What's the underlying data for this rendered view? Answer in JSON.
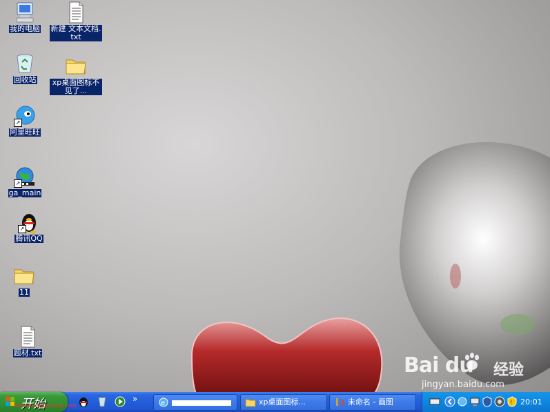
{
  "desktop": {
    "icons": [
      {
        "label": "我的电脑"
      },
      {
        "label": "新建 文本文档.txt"
      },
      {
        "label": "回收站"
      },
      {
        "label": "xp桌面图标不见了..."
      },
      {
        "label": "阿里旺旺"
      },
      {
        "label": "ga_main"
      },
      {
        "label": "腾讯QQ"
      },
      {
        "label": "11"
      },
      {
        "label": "题材.txt"
      }
    ]
  },
  "watermark": {
    "logo": "Bai du",
    "text": "经验",
    "url": "jingyan.baidu.com"
  },
  "taskbar": {
    "start_label": "开始",
    "start_overlay": "www.xitongcheng.com",
    "tasks": [
      {
        "label": "",
        "icon": "ie-icon"
      },
      {
        "label": "xp桌面图标...",
        "icon": "folder-icon"
      },
      {
        "label": "未命名 - 画图",
        "icon": "paint-icon"
      }
    ],
    "clock": "20:01"
  },
  "colors": {
    "label_bg": "#0a246a",
    "taskbar": "#245edb",
    "start": "#3a9a3a",
    "tray": "#0f86e0"
  }
}
